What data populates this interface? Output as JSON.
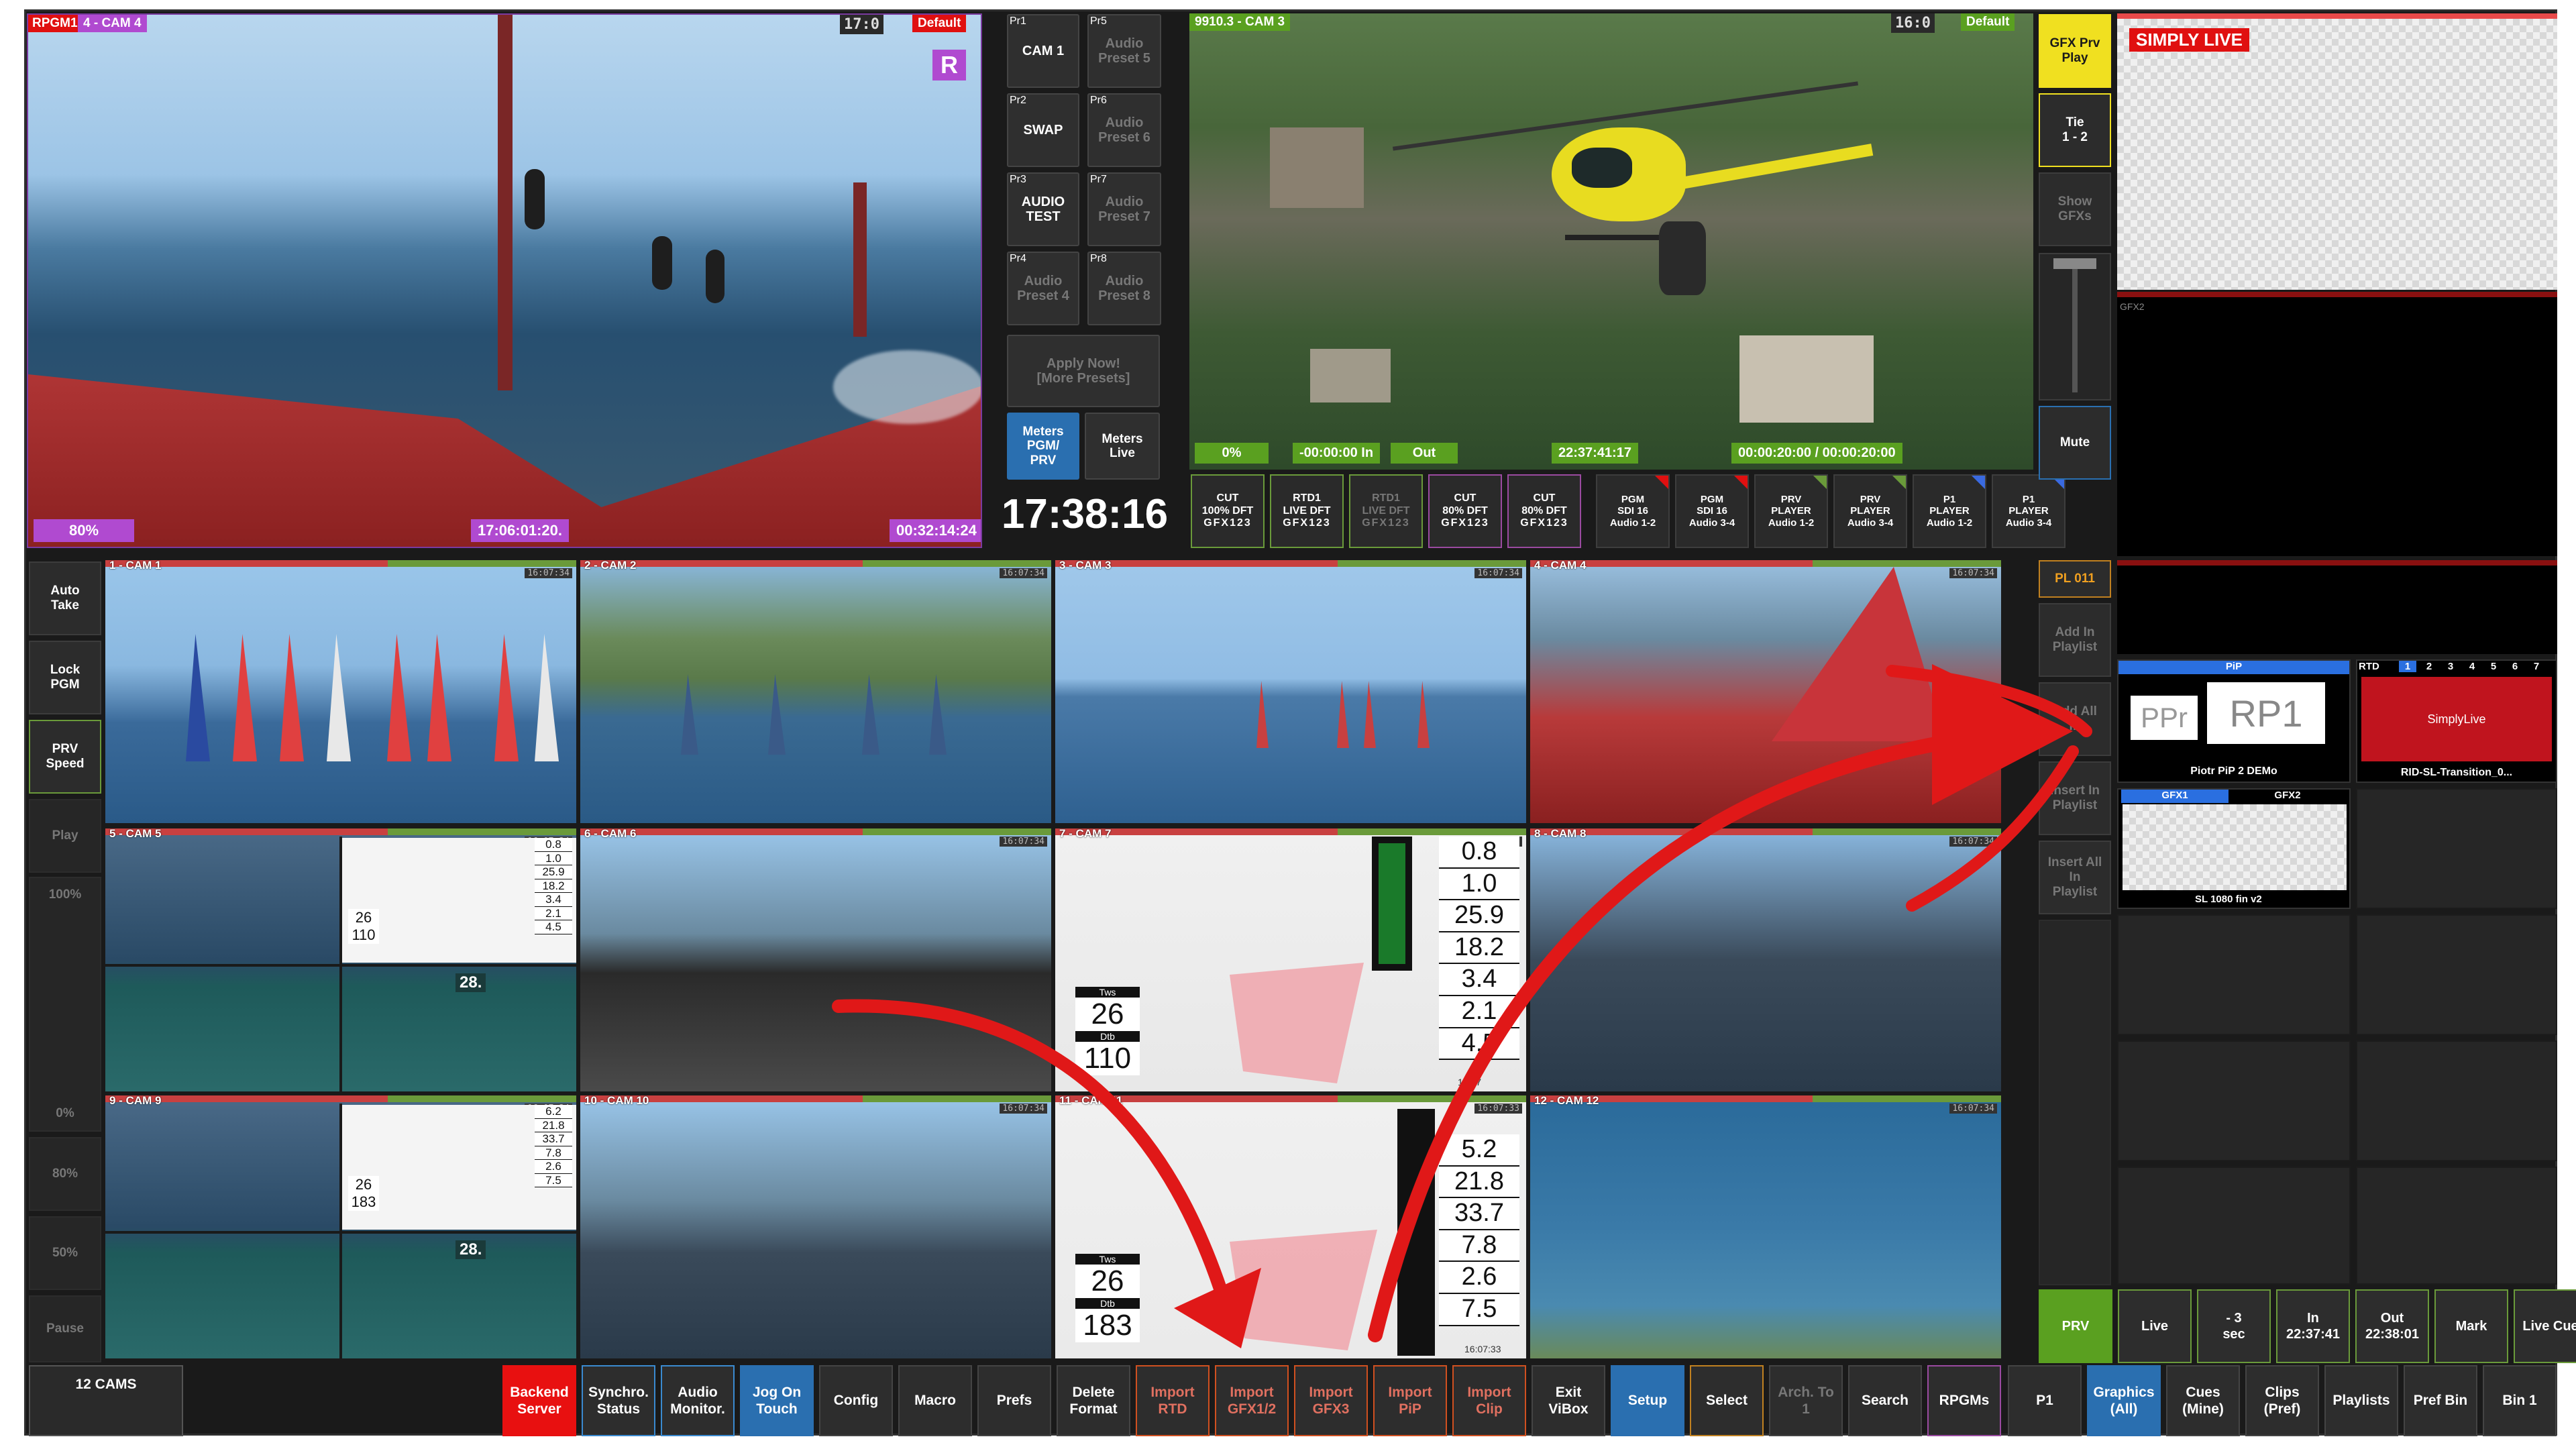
{
  "pgm": {
    "tag": "RPGM1",
    "cam": "4 - CAM 4",
    "timecode": "17:0",
    "default_badge": "Default",
    "r_badge": "R",
    "speed": "80%",
    "in_tc": "17:06:01:20.",
    "dur_tc": "00:32:14:24"
  },
  "audio_presets": [
    {
      "id": "Pr1",
      "label": "CAM 1",
      "dim": false
    },
    {
      "id": "Pr5",
      "label": "Audio\nPreset 5",
      "dim": true
    },
    {
      "id": "Pr2",
      "label": "SWAP",
      "dim": false
    },
    {
      "id": "Pr6",
      "label": "Audio\nPreset 6",
      "dim": true
    },
    {
      "id": "Pr3",
      "label": "AUDIO\nTEST",
      "dim": false
    },
    {
      "id": "Pr7",
      "label": "Audio\nPreset 7",
      "dim": true
    },
    {
      "id": "Pr4",
      "label": "Audio\nPreset 4",
      "dim": true
    },
    {
      "id": "Pr8",
      "label": "Audio\nPreset 8",
      "dim": true
    }
  ],
  "apply_now": "Apply Now!\n[More Presets]",
  "meters_pgm": "Meters\nPGM/\nPRV",
  "meters_live": "Meters\nLive",
  "clock": "17:38:16",
  "prv": {
    "cam": "9910.3 - CAM 3",
    "timecode": "16:0",
    "default_badge": "Default",
    "speed": "0%",
    "in_tc": "-00:00:00 In",
    "out": "Out",
    "time": "22:37:41:17",
    "dur": "00:00:20:00 / 00:00:20:00"
  },
  "transitions": [
    {
      "l1": "CUT",
      "l2": "100% DFT",
      "l3": "GFX123",
      "dim": false,
      "accent": "#6a9a3a"
    },
    {
      "l1": "RTD1",
      "l2": "LIVE DFT",
      "l3": "GFX123",
      "dim": false,
      "accent": "#6a9a3a"
    },
    {
      "l1": "RTD1",
      "l2": "LIVE DFT",
      "l3": "GFX123",
      "dim": true,
      "accent": "#6a9a3a"
    },
    {
      "l1": "CUT",
      "l2": "80% DFT",
      "l3": "GFX123",
      "dim": false,
      "accent": "#9a4aa0"
    },
    {
      "l1": "CUT",
      "l2": "80% DFT",
      "l3": "GFX123",
      "dim": false,
      "accent": "#9a4aa0"
    }
  ],
  "audio_routes": [
    {
      "l1": "PGM",
      "l2": "SDI 16",
      "l3": "Audio 1-2",
      "corner": "#e01010"
    },
    {
      "l1": "PGM",
      "l2": "SDI 16",
      "l3": "Audio 3-4",
      "corner": "#e01010"
    },
    {
      "l1": "PRV",
      "l2": "PLAYER",
      "l3": "Audio 1-2",
      "corner": "#6a9a3a"
    },
    {
      "l1": "PRV",
      "l2": "PLAYER",
      "l3": "Audio 3-4",
      "corner": "#6a9a3a"
    },
    {
      "l1": "P1",
      "l2": "PLAYER",
      "l3": "Audio 1-2",
      "corner": "#3a6ae0"
    },
    {
      "l1": "P1",
      "l2": "PLAYER",
      "l3": "Audio 3-4",
      "corner": "#3a6ae0"
    }
  ],
  "gfx_controls": {
    "gfx_prv_play": "GFX Prv\nPlay",
    "tie": "Tie\n1 - 2",
    "show_gfxs": "Show\nGFXs",
    "mute": "Mute"
  },
  "gfx_preview": {
    "logo": "SIMPLY LIVE",
    "gfx2_label": "GFX2"
  },
  "left_controls": {
    "auto_take": "Auto\nTake",
    "lock_pgm": "Lock\nPGM",
    "prv_speed": "PRV\nSpeed",
    "play": "Play",
    "pct100": "100%",
    "pct0": "0%",
    "pct80": "80%",
    "pct50": "50%",
    "pause": "Pause"
  },
  "cams": [
    {
      "name": "1 - CAM 1",
      "bar": "#c84040",
      "tc": "16:07:34"
    },
    {
      "name": "2 - CAM 2",
      "bar": "#c84040",
      "tc": "16:07:34"
    },
    {
      "name": "3 - CAM 3",
      "bar": "#c84040",
      "tc": "16:07:34"
    },
    {
      "name": "4 - CAM 4",
      "bar": "#c84040",
      "tc": "16:07:34"
    },
    {
      "name": "5 - CAM 5",
      "bar": "#c84040",
      "tc": "16:07:34"
    },
    {
      "name": "6 - CAM 6",
      "bar": "#c84040",
      "tc": "16:07:34"
    },
    {
      "name": "7 - CAM 7",
      "bar": "#c84040",
      "tc": "16:07:34"
    },
    {
      "name": "8 - CAM 8",
      "bar": "#c84040",
      "tc": "16:07:34"
    },
    {
      "name": "9 - CAM 9",
      "bar": "#c84040",
      "tc": "16:07:34"
    },
    {
      "name": "10 - CAM 10",
      "bar": "#c84040",
      "tc": "16:07:34"
    },
    {
      "name": "11 - CAM 11",
      "bar": "#c84040",
      "tc": "16:07:33"
    },
    {
      "name": "12 - CAM 12",
      "bar": "#c84040",
      "tc": "16:07:34"
    }
  ],
  "telemetry_cam7": [
    "0.8",
    "1.0",
    "25.9",
    "18.2",
    "3.4",
    "2.1",
    "4.5"
  ],
  "telemetry_cam7_big": {
    "tws_label": "Tws",
    "tws": "26",
    "dtb_label": "Dtb",
    "dtb": "110",
    "tc": "16:07"
  },
  "telemetry_cam11": [
    "5.2",
    "21.8",
    "33.7",
    "7.8",
    "2.6",
    "7.5"
  ],
  "telemetry_cam11_big": {
    "tws_label": "Tws",
    "tws": "26",
    "dtb_label": "Dtb",
    "dtb": "183",
    "tc": "16:07:33"
  },
  "telemetry_cam5": [
    "0.8",
    "1.0",
    "25.9",
    "18.2",
    "3.4",
    "2.1",
    "4.5"
  ],
  "telemetry_cam5_big": {
    "tws": "26",
    "dtb": "110",
    "speed": "28."
  },
  "telemetry_cam9": [
    "6.2",
    "21.8",
    "33.7",
    "7.8",
    "2.6",
    "7.5"
  ],
  "telemetry_cam9_big": {
    "tws": "26",
    "dtb": "183",
    "speed": "28."
  },
  "playlist": {
    "pl": "PL 011",
    "add_in": "Add In\nPlaylist",
    "add_all_in": "Add All\nIn",
    "insert_in": "Insert In\nPlaylist",
    "insert_all_in": "Insert All\nIn\nPlaylist"
  },
  "gfx_bin": {
    "pip_header": "PiP",
    "pip_ppr": "PPr",
    "pip_rp1": "RP1",
    "pip_label": "Piotr PiP 2 DEMo",
    "rtd_header": "RTD",
    "rtd_tabs": [
      "1",
      "2",
      "3",
      "4",
      "5",
      "6",
      "7"
    ],
    "rtd_logo": "SimplyLive",
    "rtd_label": "RID-SL-Transition_0...",
    "gfx1_header": "GFX1",
    "gfx2_header": "GFX2",
    "gfx_label": "SL 1080 fin v2"
  },
  "player_controls": [
    {
      "label": "PRV",
      "bg": "#5aa020",
      "border": "#5aa020"
    },
    {
      "label": "Live",
      "bg": "#2d2d2d",
      "border": "#6a9a3a"
    },
    {
      "label": "- 3\nsec",
      "bg": "#2d2d2d",
      "border": "#6a9a3a"
    },
    {
      "label": "In\n22:37:41",
      "bg": "#2d2d2d",
      "border": "#6a9a3a"
    },
    {
      "label": "Out\n22:38:01",
      "bg": "#2d2d2d",
      "border": "#6a9a3a"
    },
    {
      "label": "Mark",
      "bg": "#2d2d2d",
      "border": "#6a9a3a"
    },
    {
      "label": "Live Cue",
      "bg": "#2d2d2d",
      "border": "#6a9a3a"
    }
  ],
  "bottom_bar": [
    {
      "label": "12 CAMS",
      "bg": "#2a2a2a",
      "border": "#555",
      "color": "#fff"
    },
    {
      "label": "Backend\nServer",
      "bg": "#e81010",
      "border": "#e81010",
      "color": "#fff"
    },
    {
      "label": "Synchro.\nStatus",
      "bg": "#2d2d2d",
      "border": "#3a8ad0",
      "color": "#fff"
    },
    {
      "label": "Audio\nMonitor.",
      "bg": "#2d2d2d",
      "border": "#3a8ad0",
      "color": "#fff"
    },
    {
      "label": "Jog On\nTouch",
      "bg": "#2a6fb0",
      "border": "#2a6fb0",
      "color": "#fff"
    },
    {
      "label": "Config",
      "bg": "#2d2d2d",
      "border": "#444",
      "color": "#fff"
    },
    {
      "label": "Macro",
      "bg": "#2d2d2d",
      "border": "#444",
      "color": "#fff"
    },
    {
      "label": "Prefs",
      "bg": "#2d2d2d",
      "border": "#444",
      "color": "#fff"
    },
    {
      "label": "Delete\nFormat",
      "bg": "#2d2d2d",
      "border": "#444",
      "color": "#fff"
    },
    {
      "label": "Import\nRTD",
      "bg": "#2d2d2d",
      "border": "#d05020",
      "color": "#e07060"
    },
    {
      "label": "Import\nGFX1/2",
      "bg": "#2d2d2d",
      "border": "#d05020",
      "color": "#e07060"
    },
    {
      "label": "Import\nGFX3",
      "bg": "#2d2d2d",
      "border": "#d05020",
      "color": "#e07060"
    },
    {
      "label": "Import\nPiP",
      "bg": "#2d2d2d",
      "border": "#d05020",
      "color": "#e07060"
    },
    {
      "label": "Import\nClip",
      "bg": "#2d2d2d",
      "border": "#d05020",
      "color": "#e07060"
    },
    {
      "label": "Exit\nViBox",
      "bg": "#2d2d2d",
      "border": "#444",
      "color": "#fff"
    },
    {
      "label": "Setup",
      "bg": "#2a6fb0",
      "border": "#2a6fb0",
      "color": "#fff"
    },
    {
      "label": "Select",
      "bg": "#2d2d2d",
      "border": "#c08020",
      "color": "#fff"
    },
    {
      "label": "Arch. To\n1",
      "bg": "#2d2d2d",
      "border": "#444",
      "color": "#777"
    },
    {
      "label": "Search",
      "bg": "#2d2d2d",
      "border": "#444",
      "color": "#fff"
    },
    {
      "label": "RPGMs",
      "bg": "#2d2d2d",
      "border": "#9a4aa0",
      "color": "#fff"
    },
    {
      "label": "P1",
      "bg": "#2d2d2d",
      "border": "#444",
      "color": "#fff"
    },
    {
      "label": "Graphics\n(All)",
      "bg": "#2a6fb0",
      "border": "#2a6fb0",
      "color": "#fff"
    },
    {
      "label": "Cues\n(Mine)",
      "bg": "#2d2d2d",
      "border": "#444",
      "color": "#fff"
    },
    {
      "label": "Clips\n(Pref)",
      "bg": "#2d2d2d",
      "border": "#444",
      "color": "#fff"
    },
    {
      "label": "Playlists",
      "bg": "#2d2d2d",
      "border": "#444",
      "color": "#fff"
    },
    {
      "label": "Pref Bin",
      "bg": "#2d2d2d",
      "border": "#444",
      "color": "#fff"
    },
    {
      "label": "Bin 1",
      "bg": "#2d2d2d",
      "border": "#444",
      "color": "#fff"
    }
  ],
  "colors": {
    "accent_red": "#e01010",
    "accent_green": "#6a9a3a",
    "accent_yellow": "#f0e020",
    "accent_blue": "#2a6fb0",
    "accent_purple": "#b04ad0",
    "arrow_red": "#e01818"
  }
}
